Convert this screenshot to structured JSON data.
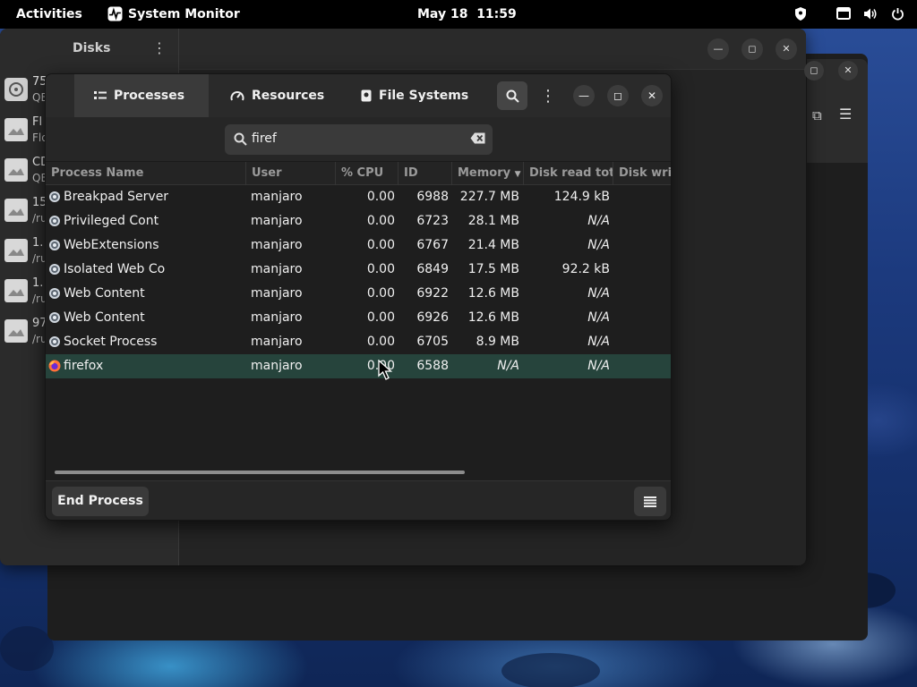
{
  "topbar": {
    "activities": "Activities",
    "app_name": "System Monitor",
    "date": "May 18",
    "time": "11:59",
    "tray_icons": [
      "shield-icon",
      "display-icon",
      "volume-icon",
      "power-icon"
    ]
  },
  "disks_window": {
    "title": "Disks",
    "items": [
      {
        "line1": "75",
        "line2": "QE",
        "icon": "harddisk-icon"
      },
      {
        "line1": "Fl",
        "line2": "Flo",
        "icon": "drive-icon"
      },
      {
        "line1": "CD",
        "line2": "QE",
        "icon": "drive-icon"
      },
      {
        "line1": "15",
        "line2": "/ru",
        "icon": "drive-icon"
      },
      {
        "line1": "1.",
        "line2": "/ru",
        "icon": "drive-icon"
      },
      {
        "line1": "1.",
        "line2": "/ru",
        "icon": "drive-icon"
      },
      {
        "line1": "97",
        "line2": "/ru",
        "icon": "drive-icon"
      }
    ]
  },
  "sysmon": {
    "tabs": [
      {
        "label": "Processes",
        "icon": "list-icon",
        "active": true
      },
      {
        "label": "Resources",
        "icon": "gauge-icon",
        "active": false
      },
      {
        "label": "File Systems",
        "icon": "disk-icon",
        "active": false
      }
    ],
    "search_value": "firef",
    "columns": [
      "Process Name",
      "User",
      "% CPU",
      "ID",
      "Memory",
      "Disk read total",
      "Disk write"
    ],
    "sort_column": "Memory",
    "rows": [
      {
        "name": "Breakpad Server",
        "user": "manjaro",
        "cpu": "0.00",
        "id": "6988",
        "memory": "227.7 MB",
        "disk_read": "124.9 kB",
        "icon": "gear-icon",
        "selected": false
      },
      {
        "name": "Privileged Cont",
        "user": "manjaro",
        "cpu": "0.00",
        "id": "6723",
        "memory": "28.1 MB",
        "disk_read": "N/A",
        "icon": "gear-icon",
        "selected": false
      },
      {
        "name": "WebExtensions",
        "user": "manjaro",
        "cpu": "0.00",
        "id": "6767",
        "memory": "21.4 MB",
        "disk_read": "N/A",
        "icon": "gear-icon",
        "selected": false
      },
      {
        "name": "Isolated Web Co",
        "user": "manjaro",
        "cpu": "0.00",
        "id": "6849",
        "memory": "17.5 MB",
        "disk_read": "92.2 kB",
        "icon": "gear-icon",
        "selected": false
      },
      {
        "name": "Web Content",
        "user": "manjaro",
        "cpu": "0.00",
        "id": "6922",
        "memory": "12.6 MB",
        "disk_read": "N/A",
        "icon": "gear-icon",
        "selected": false
      },
      {
        "name": "Web Content",
        "user": "manjaro",
        "cpu": "0.00",
        "id": "6926",
        "memory": "12.6 MB",
        "disk_read": "N/A",
        "icon": "gear-icon",
        "selected": false
      },
      {
        "name": "Socket Process",
        "user": "manjaro",
        "cpu": "0.00",
        "id": "6705",
        "memory": "8.9 MB",
        "disk_read": "N/A",
        "icon": "gear-icon",
        "selected": false
      },
      {
        "name": "firefox",
        "user": "manjaro",
        "cpu": "0.00",
        "id": "6588",
        "memory": "N/A",
        "disk_read": "N/A",
        "icon": "firefox-icon",
        "selected": true
      }
    ],
    "end_process_label": "End Process"
  },
  "colors": {
    "selection": "#26443c",
    "window_bg": "#1e1e1e",
    "headerbar": "#2a2a2a"
  }
}
